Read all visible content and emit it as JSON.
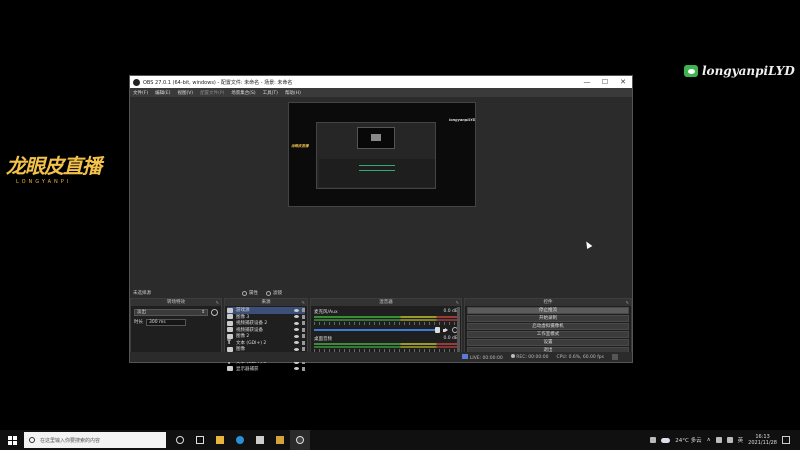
{
  "brand": {
    "main": "龙眼皮直播",
    "sub": "LONGYANPI"
  },
  "wechat": {
    "icon": "wechat-icon",
    "handle": "longyanpiLYD"
  },
  "obs": {
    "title": "OBS 27.0.1 (64-bit, windows) - 配置文件: 未命名 - 场景: 未命名",
    "window_controls": [
      "—",
      "☐",
      "✕"
    ],
    "menu": [
      {
        "label": "文件(F)",
        "enabled": true
      },
      {
        "label": "编辑(E)",
        "enabled": true
      },
      {
        "label": "视图(V)",
        "enabled": true
      },
      {
        "label": "配置文件(P)",
        "enabled": false
      },
      {
        "label": "场景集合(S)",
        "enabled": true
      },
      {
        "label": "工具(T)",
        "enabled": true
      },
      {
        "label": "帮助(H)",
        "enabled": true
      }
    ],
    "preview": {
      "mini_logo": "龙眼皮直播",
      "mini_wechat": "longyanpiLYD"
    },
    "scene_row": {
      "label": "未选择源",
      "properties": "属性",
      "filters": "滤镜"
    },
    "transitions": {
      "title": "转场特效",
      "selected": "淡出",
      "duration_label": "时长",
      "duration_value": "300 ms",
      "tabs": [
        "转场特效",
        "场景"
      ]
    },
    "sources": {
      "title": "来源",
      "items": [
        {
          "label": "游戏源",
          "icon": "game-icon"
        },
        {
          "label": "图像 3",
          "icon": "image-icon"
        },
        {
          "label": "视频捕获设备 2",
          "icon": "camera-icon"
        },
        {
          "label": "视频捕获设备",
          "icon": "camera-icon"
        },
        {
          "label": "图像 2",
          "icon": "image-icon"
        },
        {
          "label": "文本 (GDI+) 2",
          "icon": "text-icon"
        },
        {
          "label": "图像",
          "icon": "image-icon"
        },
        {
          "label": "文本 (GDI+)",
          "icon": "text-icon"
        },
        {
          "label": "文本 (GDI+) 3",
          "icon": "text-icon"
        },
        {
          "label": "显示器捕获",
          "icon": "monitor-icon"
        }
      ],
      "tools": [
        "+",
        "−",
        "⚙",
        "∧",
        "∨"
      ]
    },
    "mixer": {
      "title": "混音器",
      "tracks": [
        {
          "name": "麦克风/Aux",
          "db": "0.0 dB"
        },
        {
          "name": "桌面音频",
          "db": "0.0 dB"
        }
      ]
    },
    "controls": {
      "title": "控件",
      "buttons": [
        {
          "label": "停止推流",
          "active": true
        },
        {
          "label": "开始录制",
          "active": false
        },
        {
          "label": "启动虚拟摄像机",
          "active": false
        },
        {
          "label": "工作室模式",
          "active": false
        },
        {
          "label": "设置",
          "active": false
        },
        {
          "label": "退出",
          "active": false
        }
      ]
    },
    "status": {
      "live": "LIVE: 00:00:00",
      "rec": "REC: 00:00:00",
      "cpu": "CPU: 0.6%, 60.00 fps"
    }
  },
  "taskbar": {
    "search_placeholder": "在这里输入你要搜索的内容",
    "weather": "24°C 多云",
    "ime": "英",
    "time": "16:13",
    "date": "2021/11/28"
  }
}
